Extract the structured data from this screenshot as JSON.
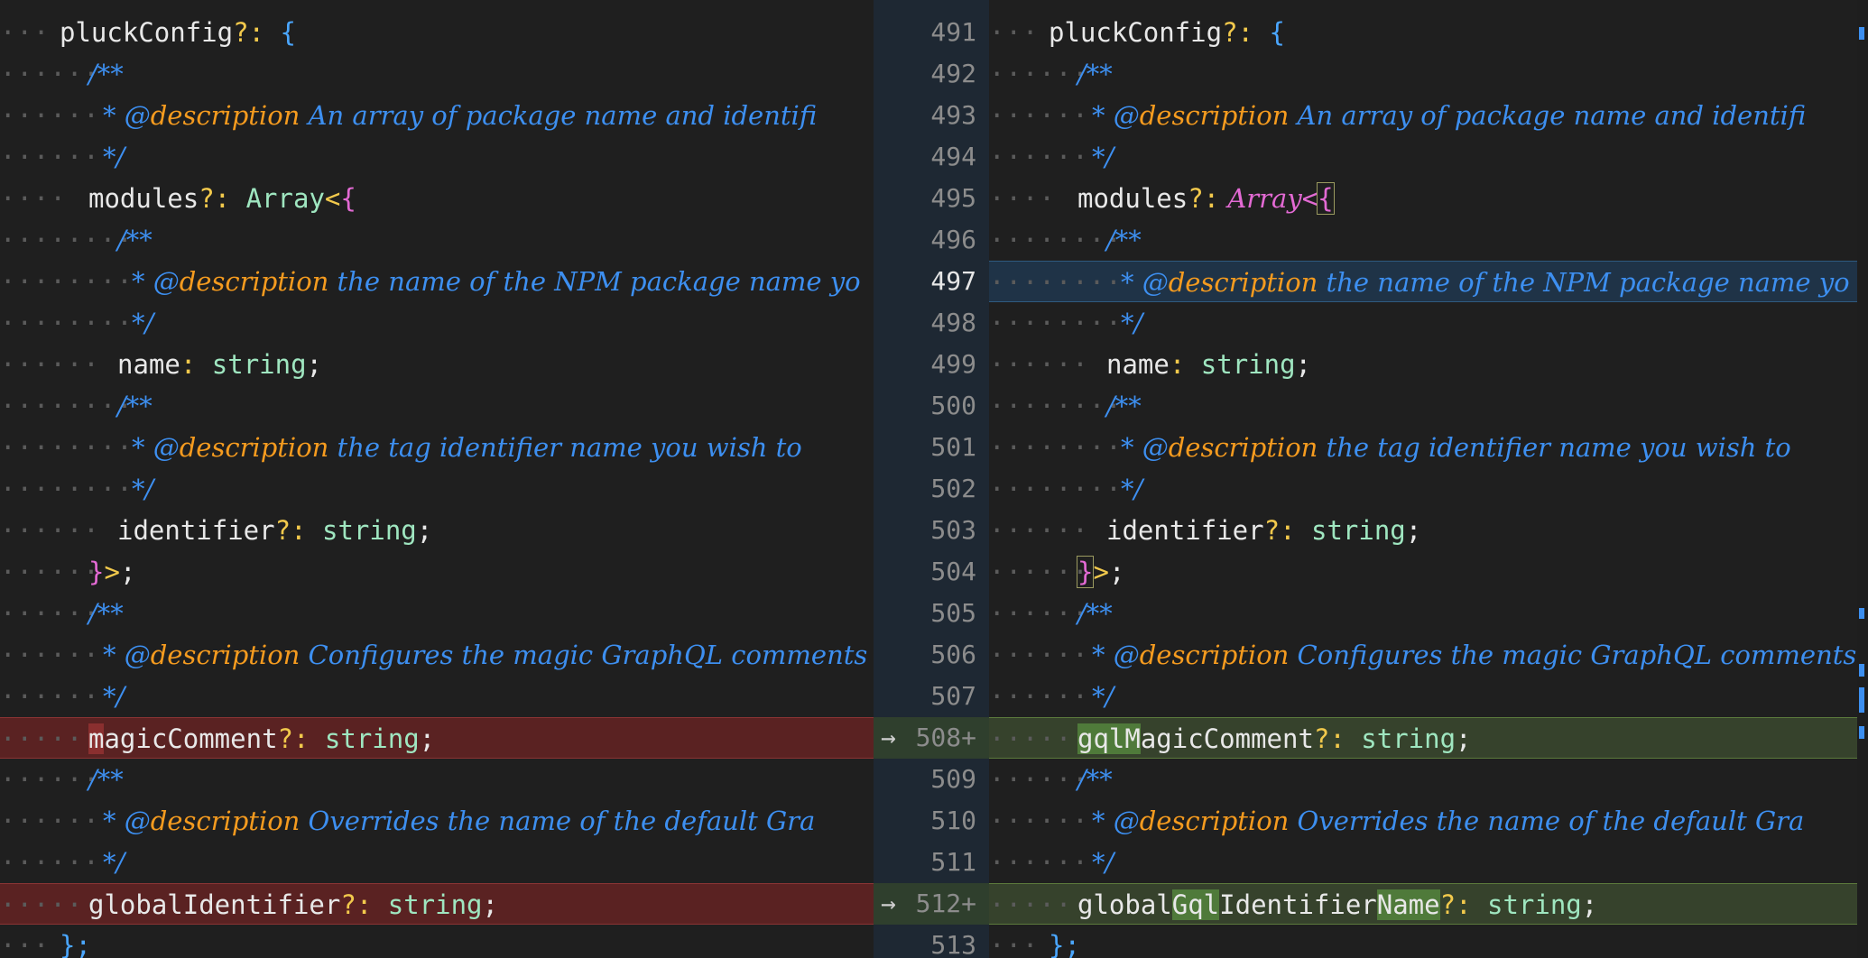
{
  "left": {
    "l1_a": "pluckConfig",
    "l1_b": "?:",
    "l1_c": " {",
    "l2": "/**",
    "l3_a": "* @",
    "l3_b": "description",
    "l3_c": " An array of package name and identifi",
    "l4": "*/",
    "l5_a": "modules",
    "l5_b": "?:",
    "l5_c": " Array",
    "l5_d": "<",
    "l5_e": "{",
    "l6": "/**",
    "l7_a": "* @",
    "l7_b": "description",
    "l7_c": " the name of the NPM package name yo",
    "l8": "*/",
    "l9_a": "name",
    "l9_b": ":",
    "l9_c": " string",
    "l9_d": ";",
    "l10": "/**",
    "l11_a": "* @",
    "l11_b": "description",
    "l11_c": " the tag identifier name you wish to",
    "l12": "*/",
    "l13_a": "identifier",
    "l13_b": "?:",
    "l13_c": " string",
    "l13_d": ";",
    "l14_a": "}",
    "l14_b": ">",
    "l14_c": ";",
    "l15": "/**",
    "l16_a": "* @",
    "l16_b": "description",
    "l16_c": " Configures the magic GraphQL comments",
    "l17": "*/",
    "l18_a": "m",
    "l18_b": "agicComment",
    "l18_c": "?:",
    "l18_d": " string",
    "l18_e": ";",
    "l19": "/**",
    "l20_a": "* @",
    "l20_b": "description",
    "l20_c": " Overrides the name of the default Gra",
    "l21": "*/",
    "l22_a": "globalIdentifier",
    "l22_b": "?:",
    "l22_c": " string",
    "l22_d": ";",
    "l23": "};"
  },
  "gutter": {
    "n491": "491",
    "n492": "492",
    "n493": "493",
    "n494": "494",
    "n495": "495",
    "n496": "496",
    "n497": "497",
    "n498": "498",
    "n499": "499",
    "n500": "500",
    "n501": "501",
    "n502": "502",
    "n503": "503",
    "n504": "504",
    "n505": "505",
    "n506": "506",
    "n507": "507",
    "n508": "508+",
    "n509": "509",
    "n510": "510",
    "n511": "511",
    "n512": "512+",
    "n513": "513",
    "arrow": "→"
  },
  "right": {
    "l1_a": "pluckConfig",
    "l1_b": "?:",
    "l1_c": " {",
    "l2": "/**",
    "l3_a": "* @",
    "l3_b": "description",
    "l3_c": " An array of package name and identifi",
    "l4": "*/",
    "l5_a": "modules",
    "l5_b": "?:",
    "l5_c": " Array",
    "l5_d": "<",
    "l5_e": "{",
    "l6": "/**",
    "l7_a": "* @",
    "l7_b": "description",
    "l7_c": " the name of the NPM package name yo",
    "l8": "*/",
    "l9_a": "name",
    "l9_b": ":",
    "l9_c": " string",
    "l9_d": ";",
    "l10": "/**",
    "l11_a": "* @",
    "l11_b": "description",
    "l11_c": " the tag identifier name you wish to",
    "l12": "*/",
    "l13_a": "identifier",
    "l13_b": "?:",
    "l13_c": " string",
    "l13_d": ";",
    "l14_a": "}",
    "l14_b": ">",
    "l14_c": ";",
    "l15": "/**",
    "l16_a": "* @",
    "l16_b": "description",
    "l16_c": " Configures the magic GraphQL comments",
    "l17": "*/",
    "l18_a": "gqlM",
    "l18_b": "agicComment",
    "l18_c": "?:",
    "l18_d": " string",
    "l18_e": ";",
    "l19": "/**",
    "l20_a": "* @",
    "l20_b": "description",
    "l20_c": " Overrides the name of the default Gra",
    "l21": "*/",
    "l22_a": "global",
    "l22_b": "Gql",
    "l22_c": "Identifier",
    "l22_d": "Name",
    "l22_e": "?:",
    "l22_f": " string",
    "l22_g": ";",
    "l23": "};"
  },
  "colors": {
    "deleted_line": "#5a2222",
    "added_line": "#36422c",
    "selected_line": "#1f3347",
    "comment": "#3d8ff0",
    "comment_tag": "#f59b1f"
  }
}
